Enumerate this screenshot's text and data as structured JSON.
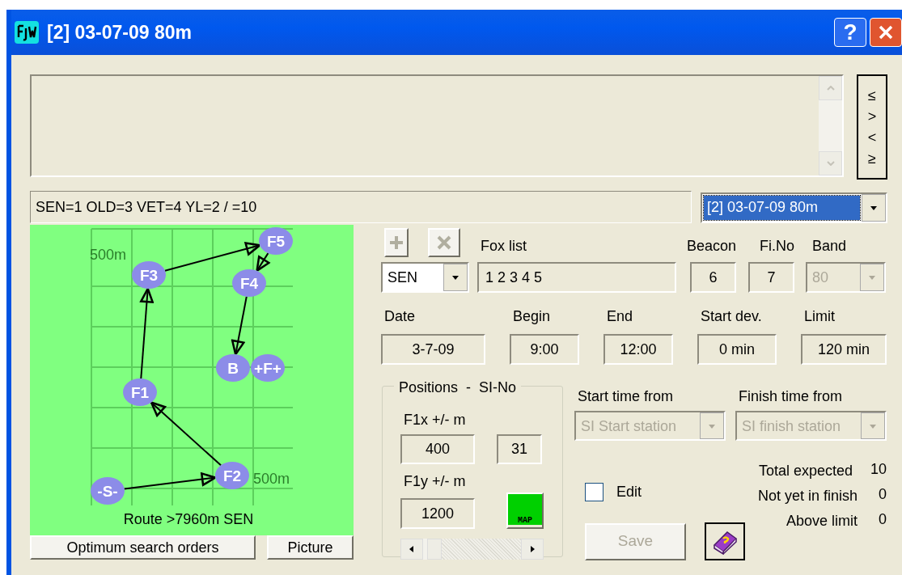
{
  "window": {
    "title": "[2] 03-07-09 80m",
    "help_label": "?"
  },
  "nav_buttons": [
    "≤",
    ">",
    "<",
    "≥"
  ],
  "summary": "SEN=1 OLD=3 VET=4 YL=2 / =10",
  "event_select": {
    "value": "[2] 03-07-09 80m",
    "selected": true
  },
  "map": {
    "scale_labels": [
      "500m",
      "500m"
    ],
    "route_label": "Route >7960m  SEN",
    "nodes": [
      {
        "label": "-S-"
      },
      {
        "label": "F2"
      },
      {
        "label": "F1"
      },
      {
        "label": "F3"
      },
      {
        "label": "F5"
      },
      {
        "label": "F4"
      },
      {
        "label": "B"
      }
    ],
    "finish_node": {
      "label": "+F+"
    }
  },
  "map_buttons": [
    "Optimum search orders",
    "Picture"
  ],
  "add_button": {
    "disabled": true
  },
  "delete_button": {
    "disabled": true
  },
  "class_select": {
    "value": "SEN"
  },
  "fox_list": {
    "label": "Fox list",
    "value": "1 2 3 4 5"
  },
  "beacon": {
    "label": "Beacon",
    "value": "6"
  },
  "fi_no": {
    "label": "Fi.No",
    "value": "7"
  },
  "band": {
    "label": "Band",
    "value": "80",
    "disabled": true
  },
  "times": [
    {
      "label": "Date",
      "value": "3-7-09"
    },
    {
      "label": "Begin",
      "value": "9:00"
    },
    {
      "label": "End",
      "value": "12:00"
    },
    {
      "label": "Start dev.",
      "value": "0 min"
    },
    {
      "label": "Limit",
      "value": "120 min"
    }
  ],
  "positions": {
    "title": "Positions  -  SI-No",
    "x_label": "F1x  +/- m",
    "x_value": "400",
    "si_no": "31",
    "y_label": "F1y  +/- m",
    "y_value": "1200",
    "map_button": "MAP"
  },
  "start_time": {
    "label": "Start time from",
    "value": "SI Start station",
    "disabled": true
  },
  "finish_time": {
    "label": "Finish time from",
    "value": "SI finish station",
    "disabled": true
  },
  "edit": {
    "label": "Edit",
    "checked": false
  },
  "stats": [
    {
      "label": "Total expected",
      "value": "10"
    },
    {
      "label": "Not yet in finish",
      "value": "0"
    },
    {
      "label": "Above limit",
      "value": "0"
    }
  ],
  "save_button": {
    "label": "Save",
    "disabled": true
  }
}
